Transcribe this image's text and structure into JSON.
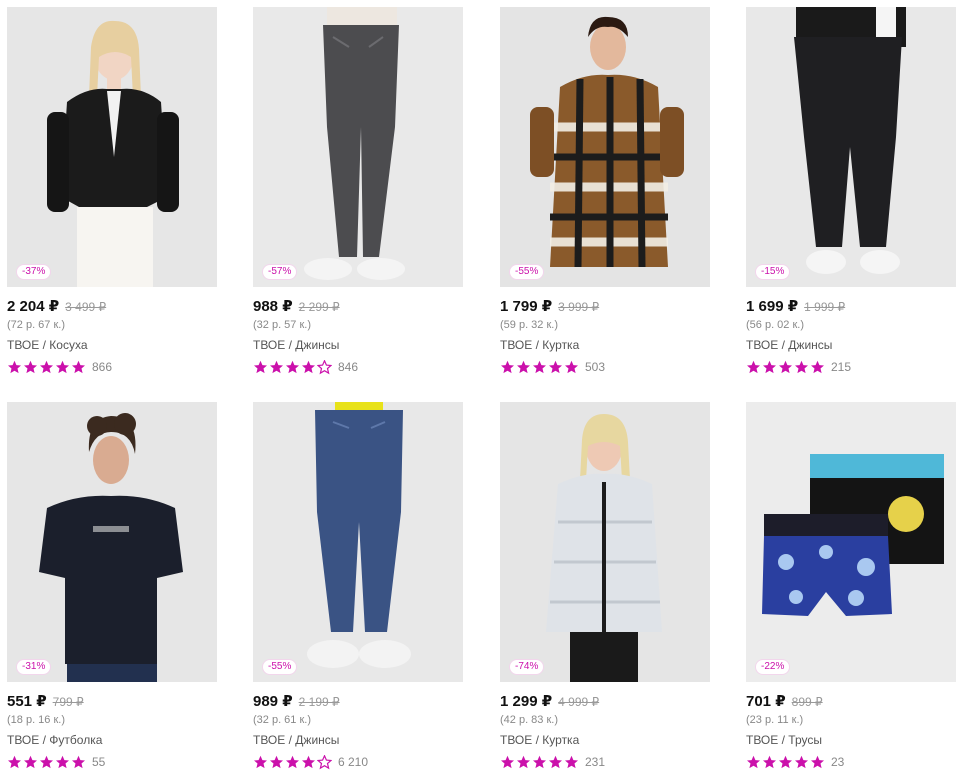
{
  "colors": {
    "accent": "#cb11ab",
    "star_empty": "#cb11ab"
  },
  "products": [
    {
      "discount": "-37%",
      "price": "2 204 ₽",
      "old_price": "3 499 ₽",
      "per_part": "(72 р. 67 к.)",
      "brand": "ТВОЕ",
      "category": "Косуха",
      "rating": 5,
      "reviews": "866",
      "image": "woman-leather-jacket",
      "bg": "#e6e6e6"
    },
    {
      "discount": "-57%",
      "price": "988 ₽",
      "old_price": "2 299 ₽",
      "per_part": "(32 р. 57 к.)",
      "brand": "ТВОЕ",
      "category": "Джинсы",
      "rating": 4,
      "reviews": "846",
      "image": "grey-jeans",
      "bg": "#e9e9e9"
    },
    {
      "discount": "-55%",
      "price": "1 799 ₽",
      "old_price": "3 999 ₽",
      "per_part": "(59 р. 32 к.)",
      "brand": "ТВОЕ",
      "category": "Куртка",
      "rating": 5,
      "reviews": "503",
      "image": "plaid-shirt-jacket",
      "bg": "#e4e4e4"
    },
    {
      "discount": "-15%",
      "price": "1 699 ₽",
      "old_price": "1 999 ₽",
      "per_part": "(56 р. 02 к.)",
      "brand": "ТВОЕ",
      "category": "Джинсы",
      "rating": 5,
      "reviews": "215",
      "image": "black-jeans",
      "bg": "#e8e8e8"
    },
    {
      "discount": "-31%",
      "price": "551 ₽",
      "old_price": "799 ₽",
      "per_part": "(18 р. 16 к.)",
      "brand": "ТВОЕ",
      "category": "Футболка",
      "rating": 5,
      "reviews": "55",
      "image": "man-black-tshirt",
      "bg": "#e6e6e6"
    },
    {
      "discount": "-55%",
      "price": "989 ₽",
      "old_price": "2 199 ₽",
      "per_part": "(32 р. 61 к.)",
      "brand": "ТВОЕ",
      "category": "Джинсы",
      "rating": 4,
      "reviews": "6 210",
      "image": "blue-mom-jeans",
      "bg": "#e8e8e8"
    },
    {
      "discount": "-74%",
      "price": "1 299 ₽",
      "old_price": "4 999 ₽",
      "per_part": "(42 р. 83 к.)",
      "brand": "ТВОЕ",
      "category": "Куртка",
      "rating": 5,
      "reviews": "231",
      "image": "white-puffer-jacket",
      "bg": "#e5e5e5"
    },
    {
      "discount": "-22%",
      "price": "701 ₽",
      "old_price": "899 ₽",
      "per_part": "(23 р. 11 к.)",
      "brand": "ТВОЕ",
      "category": "Трусы",
      "rating": 5,
      "reviews": "23",
      "image": "boxer-briefs",
      "bg": "#ececec"
    }
  ]
}
